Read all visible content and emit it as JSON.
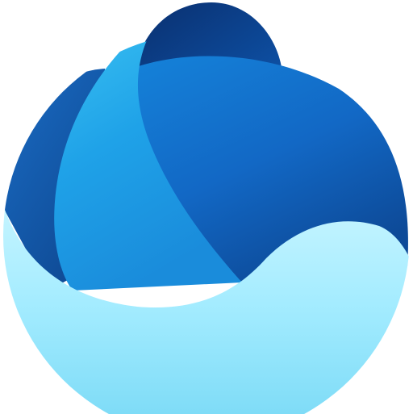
{
  "logo": {
    "icon_name": "app-logo-icon",
    "colors": {
      "navy": "#0A3F86",
      "deep_blue": "#1460B8",
      "mid_blue": "#0F7FD8",
      "sky_blue": "#24A9EC",
      "light_cyan": "#8FE3FF",
      "pale_cyan": "#C8F4FF",
      "background": "#FFFFFF"
    }
  }
}
